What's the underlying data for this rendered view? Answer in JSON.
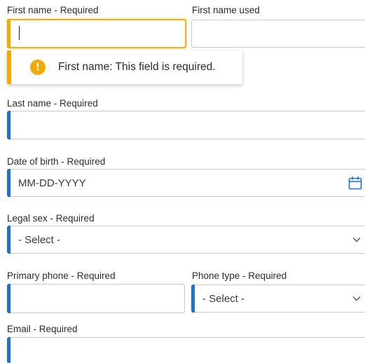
{
  "colors": {
    "required_accent": "#1f6fd1",
    "error_accent": "#f2a900",
    "border": "#c9c9c9"
  },
  "first_name": {
    "label": "First name - Required",
    "value": ""
  },
  "first_name_used": {
    "label": "First name used",
    "value": ""
  },
  "error_toast": {
    "icon": "warning-icon",
    "message": "First name: This field is required."
  },
  "last_name": {
    "label": "Last name - Required",
    "value": ""
  },
  "dob": {
    "label": "Date of birth - Required",
    "placeholder": "MM-DD-YYYY",
    "icon": "calendar-icon"
  },
  "legal_sex": {
    "label": "Legal sex - Required",
    "selected": "- Select -"
  },
  "primary_phone": {
    "label": "Primary phone - Required",
    "value": ""
  },
  "phone_type": {
    "label": "Phone type - Required",
    "selected": "- Select -"
  },
  "email": {
    "label": "Email - Required",
    "value": ""
  }
}
